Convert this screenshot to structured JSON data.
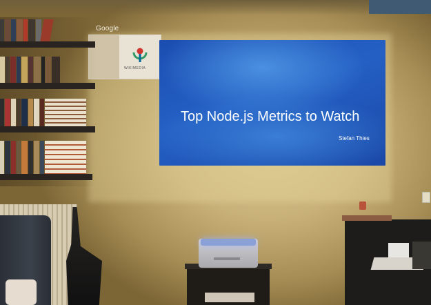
{
  "desktop": {
    "thumbnail_label": "Google",
    "thumbnail_logo_text": "WIKIMEDIA"
  },
  "slide": {
    "title": "Top Node.js Metrics to Watch",
    "author": "Stefan Thies"
  },
  "colors": {
    "slide_blue": "#2460c4",
    "wall": "#c9b27a",
    "text": "#ffffff"
  },
  "icons": [
    "wikimedia-logo-icon"
  ]
}
